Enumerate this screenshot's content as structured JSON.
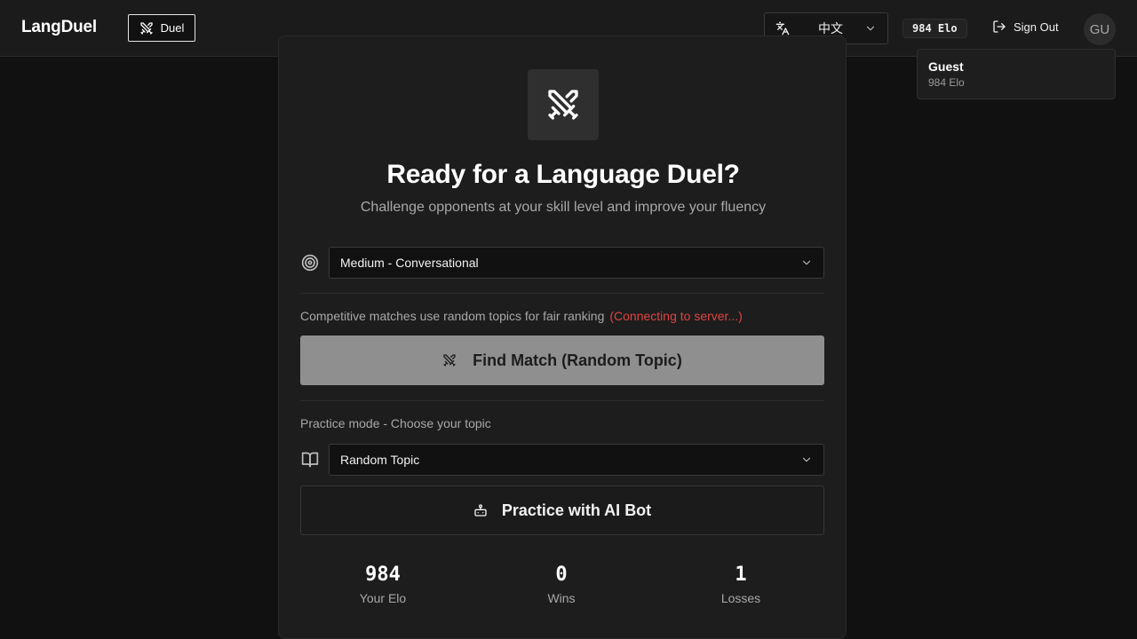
{
  "header": {
    "brand": "LangDuel",
    "nav_duel_label": "Duel",
    "language": {
      "selected": "中文",
      "icon": "translate-icon"
    },
    "elo_badge": "984 Elo",
    "sign_out_label": "Sign Out",
    "avatar_initials": "GU"
  },
  "user_popover": {
    "name": "Guest",
    "elo": "984 Elo"
  },
  "main": {
    "hero_icon": "crossed-swords-icon",
    "title": "Ready for a Language Duel?",
    "subtitle": "Challenge opponents at your skill level and improve your fluency",
    "difficulty": {
      "icon": "target-icon",
      "selected": "Medium - Conversational"
    },
    "competitive_note": "Competitive matches use random topics for fair ranking",
    "connection_status": "(Connecting to server...)",
    "find_match_label": "Find Match (Random Topic)",
    "practice_note": "Practice mode - Choose your topic",
    "topic": {
      "icon": "book-icon",
      "selected": "Random Topic"
    },
    "practice_label": "Practice with AI Bot"
  },
  "stats": [
    {
      "value": "984",
      "label": "Your Elo"
    },
    {
      "value": "0",
      "label": "Wins"
    },
    {
      "value": "1",
      "label": "Losses"
    }
  ],
  "colors": {
    "background": "#111111",
    "card": "#1d1d1d",
    "status_error": "#e04444",
    "find_button_disabled": "#8f8f8f"
  }
}
